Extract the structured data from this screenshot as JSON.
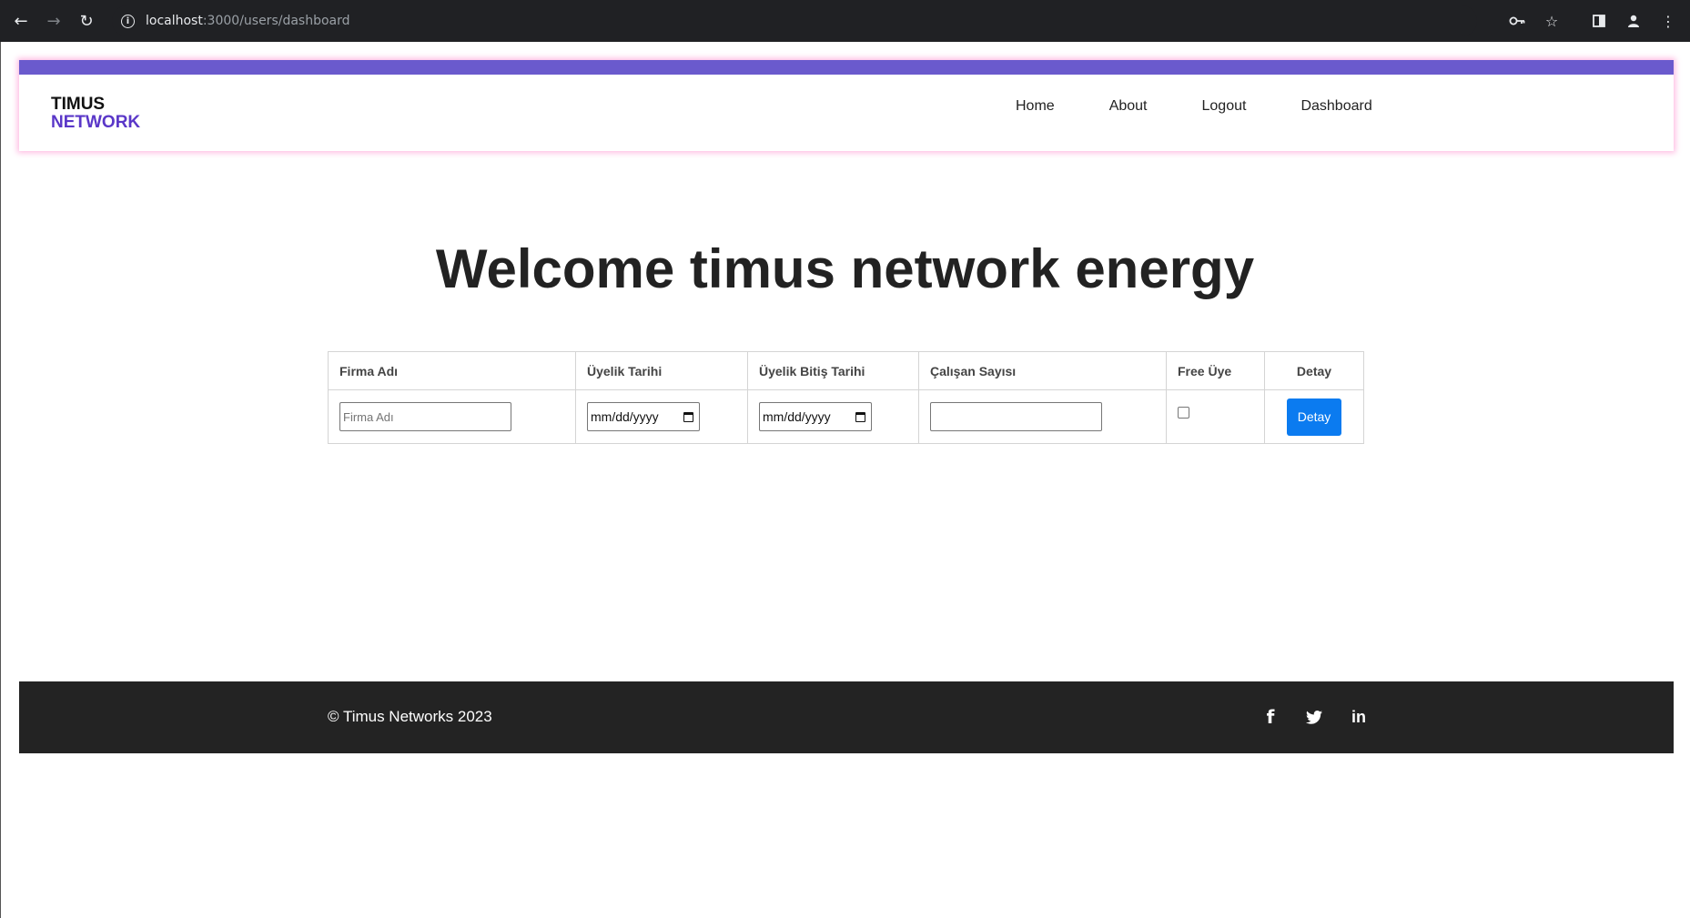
{
  "browser": {
    "url_host": "localhost",
    "url_path": ":3000/users/dashboard",
    "icons": [
      "back-icon",
      "forward-icon",
      "reload-icon",
      "info-icon",
      "key-icon",
      "star-icon",
      "side-panel-icon",
      "profile-icon",
      "menu-icon"
    ]
  },
  "navbar": {
    "logo_line1": "TIMUS",
    "logo_line2": "NETWORK",
    "links": [
      "Home",
      "About",
      "Logout",
      "Dashboard"
    ],
    "accent_color": "#6a5acd"
  },
  "main": {
    "welcome": "Welcome timus network energy"
  },
  "table": {
    "headers": [
      "Firma Adı",
      "Üyelik Tarihi",
      "Üyelik Bitiş Tarihi",
      "Çalışan Sayısı",
      "Free Üye",
      "Detay"
    ],
    "row": {
      "firma_placeholder": "Firma Adı",
      "firma_value": "",
      "uyelik_tarihi": "mm/dd/yyyy",
      "uyelik_bitis_tarihi": "mm/dd/yyyy",
      "calisan_sayisi": "",
      "free_uye_checked": false,
      "detay_button": "Detay"
    }
  },
  "footer": {
    "copyright": "© Timus Networks 2023",
    "social_icons": [
      "facebook-icon",
      "twitter-icon",
      "linkedin-icon"
    ]
  }
}
